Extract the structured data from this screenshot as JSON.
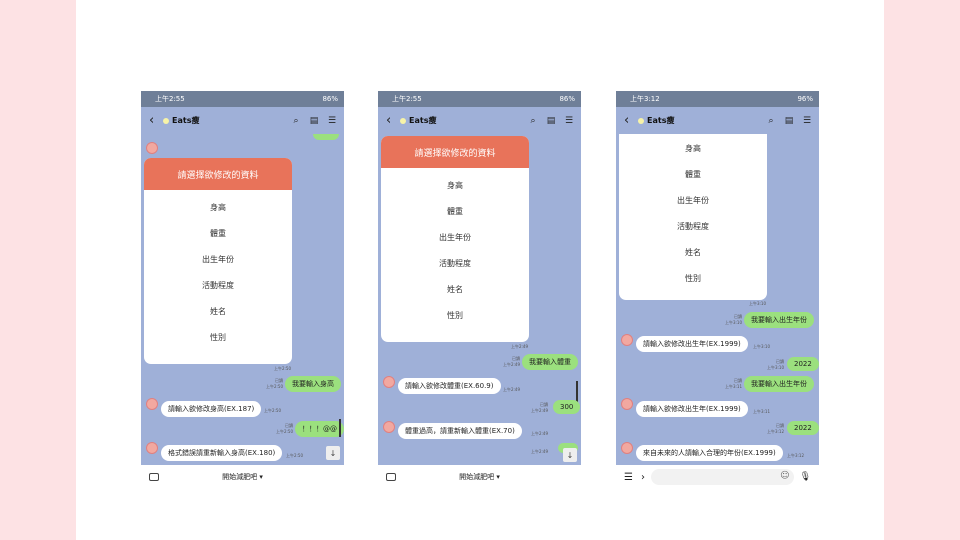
{
  "phone1": {
    "status_time": "上午2:55",
    "status_right": "86%",
    "chat_title": "Eats瘦",
    "card_header": "請選擇欲修改的資料",
    "card_items": [
      "身高",
      "體重",
      "出生年份",
      "活動程度",
      "姓名",
      "性別"
    ],
    "ts_card": "上午2:50",
    "read_label": "已讀",
    "ts_r1": "上午2:50",
    "msg_r1": "我要輸入身高",
    "msg_l1": "請輸入欲修改身高(EX.187)",
    "ts_l1": "上午2:50",
    "ts_r2": "上午2:50",
    "msg_r2": "！！！@@",
    "msg_l2": "格式錯誤請重新輸入身高(EX.180)",
    "ts_l2": "上午2:50",
    "menu_label": "開始減肥吧 ▾"
  },
  "phone2": {
    "status_time": "上午2:55",
    "status_right": "86%",
    "chat_title": "Eats瘦",
    "card_header": "請選擇欲修改的資料",
    "card_items": [
      "身高",
      "體重",
      "出生年份",
      "活動程度",
      "姓名",
      "性別"
    ],
    "ts_card": "上午2:49",
    "read_label": "已讀",
    "ts_r1": "上午2:49",
    "msg_r1": "我要輸入體重",
    "msg_l1": "請輸入欲修改體重(EX.60.9)",
    "ts_l1": "上午2:49",
    "ts_r2": "上午2:49",
    "msg_r2": "300",
    "msg_l2": "體重過高，請重新輸入體重(EX.70)",
    "ts_l2": "上午2:49",
    "ts_r3": "上午2:49",
    "menu_label": "開始減肥吧 ▾"
  },
  "phone3": {
    "status_time": "上午3:12",
    "status_right": "96%",
    "chat_title": "Eats瘦",
    "card_items": [
      "身高",
      "體重",
      "出生年份",
      "活動程度",
      "姓名",
      "性別"
    ],
    "ts_card": "上午3:10",
    "read_label": "已讀",
    "ts_r1": "上午3:10",
    "msg_r1": "我要輸入出生年份",
    "msg_l1": "請輸入欲修改出生年(EX.1999)",
    "ts_l1": "上午3:10",
    "ts_r2": "上午3:10",
    "msg_r2": "2022",
    "ts_r3": "上午3:11",
    "msg_r3": "我要輸入出生年份",
    "msg_l2": "請輸入欲修改出生年(EX.1999)",
    "ts_l2": "上午3:11",
    "ts_r4": "上午3:12",
    "msg_r4": "2022",
    "msg_l3": "來自未來的人請輸入合理的年份(EX.1999)",
    "ts_l3": "上午3:12"
  },
  "colors": {
    "background": "#fde2e4",
    "chat_bg": "#9fb0d8",
    "accent": "#e8735a",
    "user_bubble": "#9be07e"
  }
}
